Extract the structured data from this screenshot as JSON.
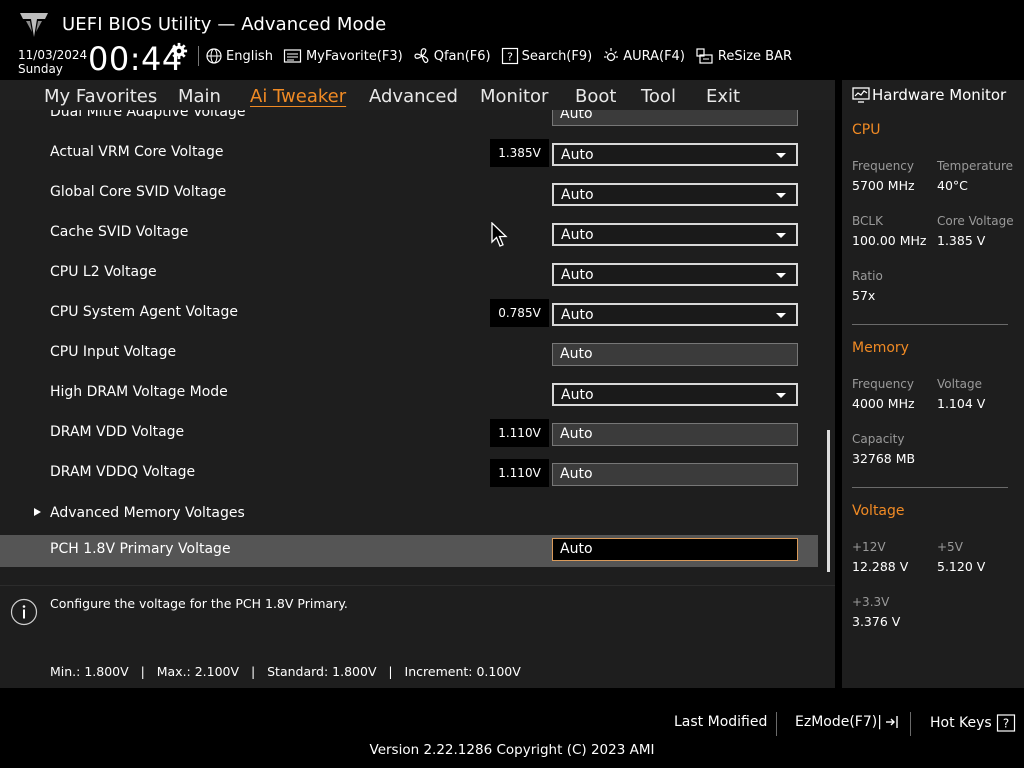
{
  "header": {
    "title": "UEFI BIOS Utility — Advanced Mode",
    "date": "11/03/2024",
    "day": "Sunday",
    "time": "00:44",
    "toolbar": [
      {
        "label": "English",
        "icon": "globe-icon"
      },
      {
        "label": "MyFavorite(F3)",
        "icon": "favorite-icon"
      },
      {
        "label": "Qfan(F6)",
        "icon": "fan-icon"
      },
      {
        "label": "Search(F9)",
        "icon": "search-icon"
      },
      {
        "label": "AURA(F4)",
        "icon": "aura-icon"
      },
      {
        "label": "ReSize BAR",
        "icon": "resize-bar-icon"
      }
    ]
  },
  "nav": {
    "tabs": [
      "My Favorites",
      "Main",
      "Ai Tweaker",
      "Advanced",
      "Monitor",
      "Boot",
      "Tool",
      "Exit"
    ],
    "active": "Ai Tweaker"
  },
  "settings": {
    "partial_top": {
      "label": "Dual Mitre Adaptive Voltage",
      "value": "Auto"
    },
    "rows": [
      {
        "label": "Actual VRM Core Voltage",
        "reading": "1.385V",
        "value": "Auto"
      },
      {
        "label": "Global Core SVID Voltage",
        "value": "Auto"
      },
      {
        "label": "Cache SVID Voltage",
        "value": "Auto"
      },
      {
        "label": "CPU L2 Voltage",
        "value": "Auto"
      },
      {
        "label": "CPU System Agent Voltage",
        "reading": "0.785V",
        "value": "Auto"
      },
      {
        "label": "CPU Input Voltage",
        "value": "Auto"
      },
      {
        "label": "High DRAM Voltage Mode",
        "value": "Auto"
      },
      {
        "label": "DRAM VDD Voltage",
        "reading": "1.110V",
        "value": "Auto"
      },
      {
        "label": "DRAM VDDQ Voltage",
        "reading": "1.110V",
        "value": "Auto"
      }
    ],
    "submenu": {
      "label": "Advanced Memory Voltages"
    },
    "selected": {
      "label": "PCH 1.8V Primary Voltage",
      "value": "Auto"
    }
  },
  "help": {
    "text": "Configure the voltage for the PCH 1.8V Primary.",
    "range": "Min.: 1.800V   |   Max.: 2.100V   |   Standard: 1.800V   |   Increment: 0.100V"
  },
  "hardware_monitor": {
    "title": "Hardware Monitor",
    "cpu": {
      "heading": "CPU",
      "frequency_label": "Frequency",
      "frequency": "5700 MHz",
      "temperature_label": "Temperature",
      "temperature": "40°C",
      "bclk_label": "BCLK",
      "bclk": "100.00 MHz",
      "core_voltage_label": "Core Voltage",
      "core_voltage": "1.385 V",
      "ratio_label": "Ratio",
      "ratio": "57x"
    },
    "memory": {
      "heading": "Memory",
      "frequency_label": "Frequency",
      "frequency": "4000 MHz",
      "voltage_label": "Voltage",
      "voltage": "1.104 V",
      "capacity_label": "Capacity",
      "capacity": "32768 MB"
    },
    "voltage": {
      "heading": "Voltage",
      "v12_label": "+12V",
      "v12": "12.288 V",
      "v5_label": "+5V",
      "v5": "5.120 V",
      "v33_label": "+3.3V",
      "v33": "3.376 V"
    }
  },
  "footer": {
    "last_modified": "Last Modified",
    "ezmode": "EzMode(F7)|",
    "hotkeys": "Hot Keys",
    "version": "Version 2.22.1286 Copyright (C) 2023 AMI"
  },
  "colors": {
    "accent": "#f08a24",
    "panel": "#1e1e1e",
    "nav": "#202020",
    "selected_row": "#555555"
  }
}
